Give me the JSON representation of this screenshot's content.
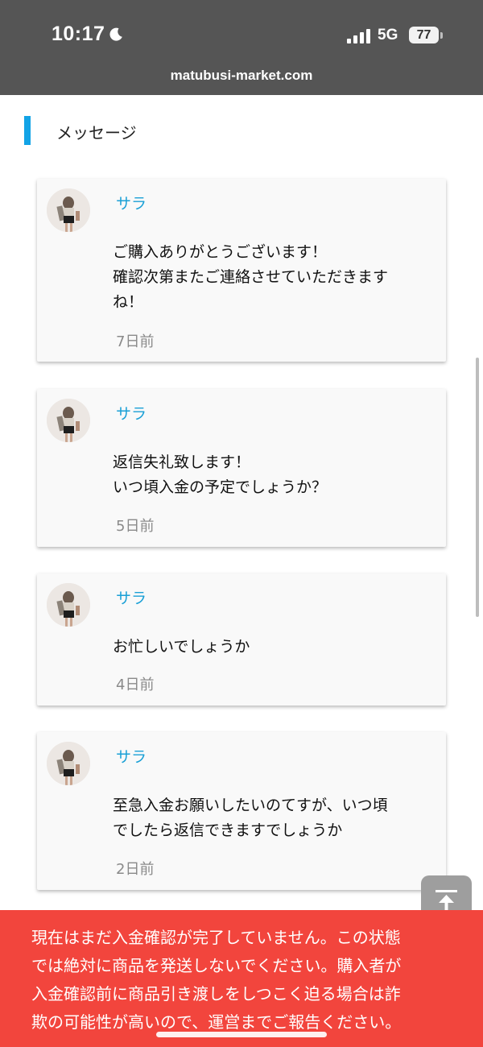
{
  "status_bar": {
    "time": "10:17",
    "network": "5G",
    "battery": "77",
    "url": "matubusi-market.com"
  },
  "section": {
    "title": "メッセージ"
  },
  "messages": [
    {
      "sender": "サラ",
      "text": "ご購入ありがとうございます！\n確認次第またご連絡させていただきます\nね！",
      "time": "7日前"
    },
    {
      "sender": "サラ",
      "text": "返信失礼致します！\nいつ頃入金の予定でしょうか？",
      "time": "5日前"
    },
    {
      "sender": "サラ",
      "text": "お忙しいでしょうか",
      "time": "4日前"
    },
    {
      "sender": "サラ",
      "text": "至急入金お願いしたいのてすが、いつ頃\nでしたら返信できますでしょうか",
      "time": "2日前"
    }
  ],
  "alert": {
    "text": "現在はまだ入金確認が完了していません。この状態\nでは絶対に商品を発送しないでください。購入者が\n入金確認前に商品引き渡しをしつこく迫る場合は詐\n欺の可能性が高いので、運営までご報告ください。"
  },
  "colors": {
    "status_bar_bg": "#555555",
    "accent_bar": "#12a3e6",
    "sender_name": "#1aa0d6",
    "alert_bg": "#f2453d"
  },
  "icons": {
    "moon": "moon-icon",
    "signal": "cellular-signal-icon",
    "battery": "battery-icon",
    "scroll_top": "arrow-to-top-icon",
    "avatar": "user-avatar"
  }
}
